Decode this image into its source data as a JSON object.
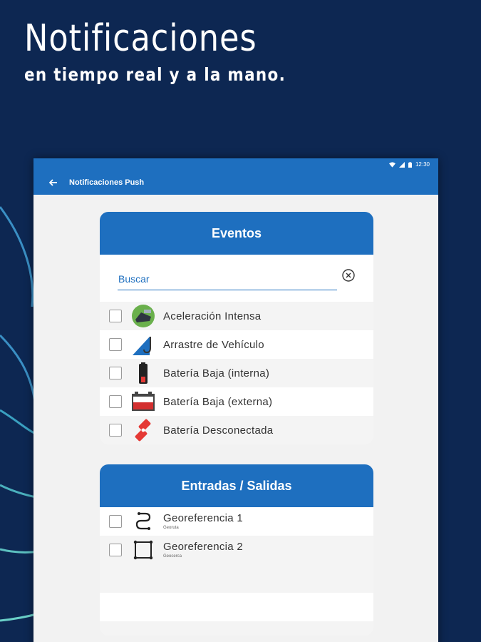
{
  "promo": {
    "title": "Notificaciones",
    "subtitle": "en tiempo real y a la mano."
  },
  "status_bar": {
    "time": "12:30"
  },
  "app_bar": {
    "title": "Notificaciones Push"
  },
  "events": {
    "title": "Eventos",
    "search": {
      "placeholder": "Buscar",
      "value": ""
    },
    "items": [
      {
        "label": "Aceleración Intensa",
        "icon": "acceleration-icon",
        "checked": false
      },
      {
        "label": "Arrastre de Vehículo",
        "icon": "tow-hook-icon",
        "checked": false
      },
      {
        "label": "Batería Baja (interna)",
        "icon": "battery-low-internal-icon",
        "checked": false
      },
      {
        "label": "Batería Baja (externa)",
        "icon": "car-battery-icon",
        "checked": false
      },
      {
        "label": "Batería Desconectada",
        "icon": "battery-disconnected-icon",
        "checked": false
      }
    ]
  },
  "io": {
    "title": "Entradas / Salidas",
    "items": [
      {
        "label": "Georeferencia 1",
        "sublabel": "Georuta",
        "icon": "route-icon",
        "checked": false
      },
      {
        "label": "Georeferencia 2",
        "sublabel": "Geocerca",
        "icon": "geofence-icon",
        "checked": false
      }
    ]
  },
  "colors": {
    "background": "#0d2752",
    "primary": "#1e6fbf",
    "accent_red": "#d32f2f"
  }
}
